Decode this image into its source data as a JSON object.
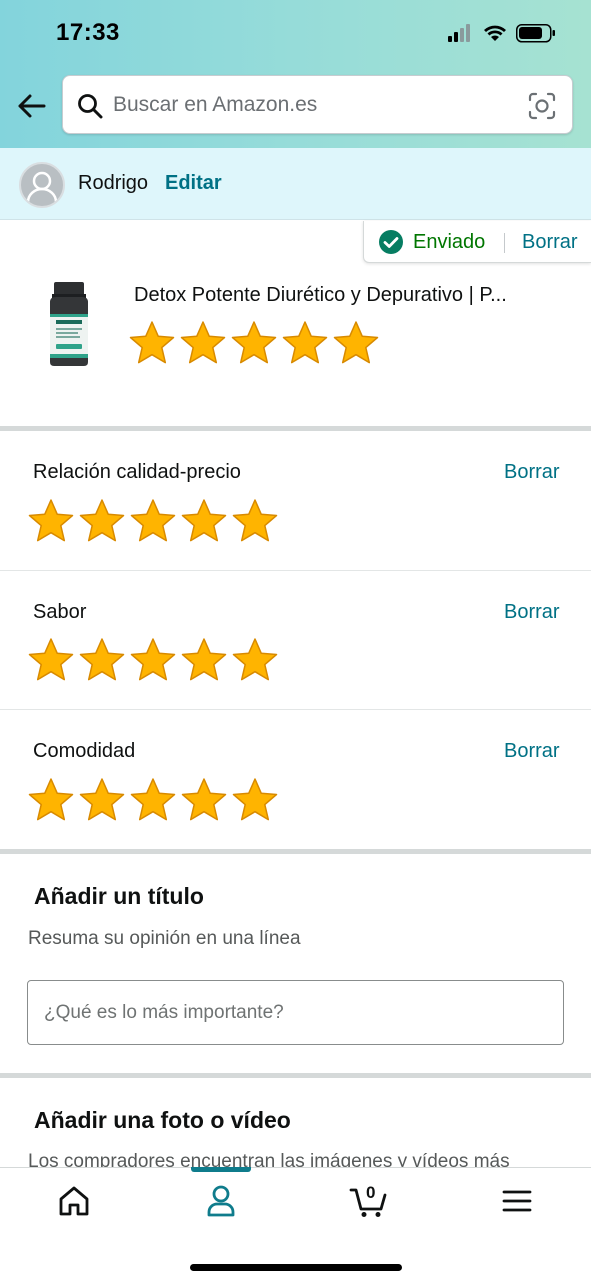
{
  "status_bar": {
    "time": "17:33"
  },
  "search": {
    "placeholder": "Buscar en Amazon.es"
  },
  "user": {
    "name": "Rodrigo",
    "edit_label": "Editar"
  },
  "review_status": {
    "label": "Enviado",
    "delete_label": "Borrar"
  },
  "product": {
    "title": "Detox Potente Diurético y Depurativo | P...",
    "overall_rating": 5,
    "max_rating": 5
  },
  "ratings": [
    {
      "label": "Relación calidad-precio",
      "value": 5,
      "delete_label": "Borrar"
    },
    {
      "label": "Sabor",
      "value": 5,
      "delete_label": "Borrar"
    },
    {
      "label": "Comodidad",
      "value": 5,
      "delete_label": "Borrar"
    }
  ],
  "title_section": {
    "heading": "Añadir un título",
    "subtitle": "Resuma su opinión en una línea",
    "input_placeholder": "¿Qué es lo más importante?"
  },
  "photo_section": {
    "heading": "Añadir una foto o vídeo",
    "subtitle": "Los compradores encuentran las imágenes y vídeos más"
  },
  "bottom_nav": {
    "items": [
      "home-icon",
      "account-icon",
      "cart-icon",
      "menu-icon"
    ],
    "active": "account",
    "cart_count": "0"
  },
  "colors": {
    "link": "#007185",
    "success": "#007600",
    "star": "#FFA41C",
    "accent": "#0f7c8c"
  }
}
